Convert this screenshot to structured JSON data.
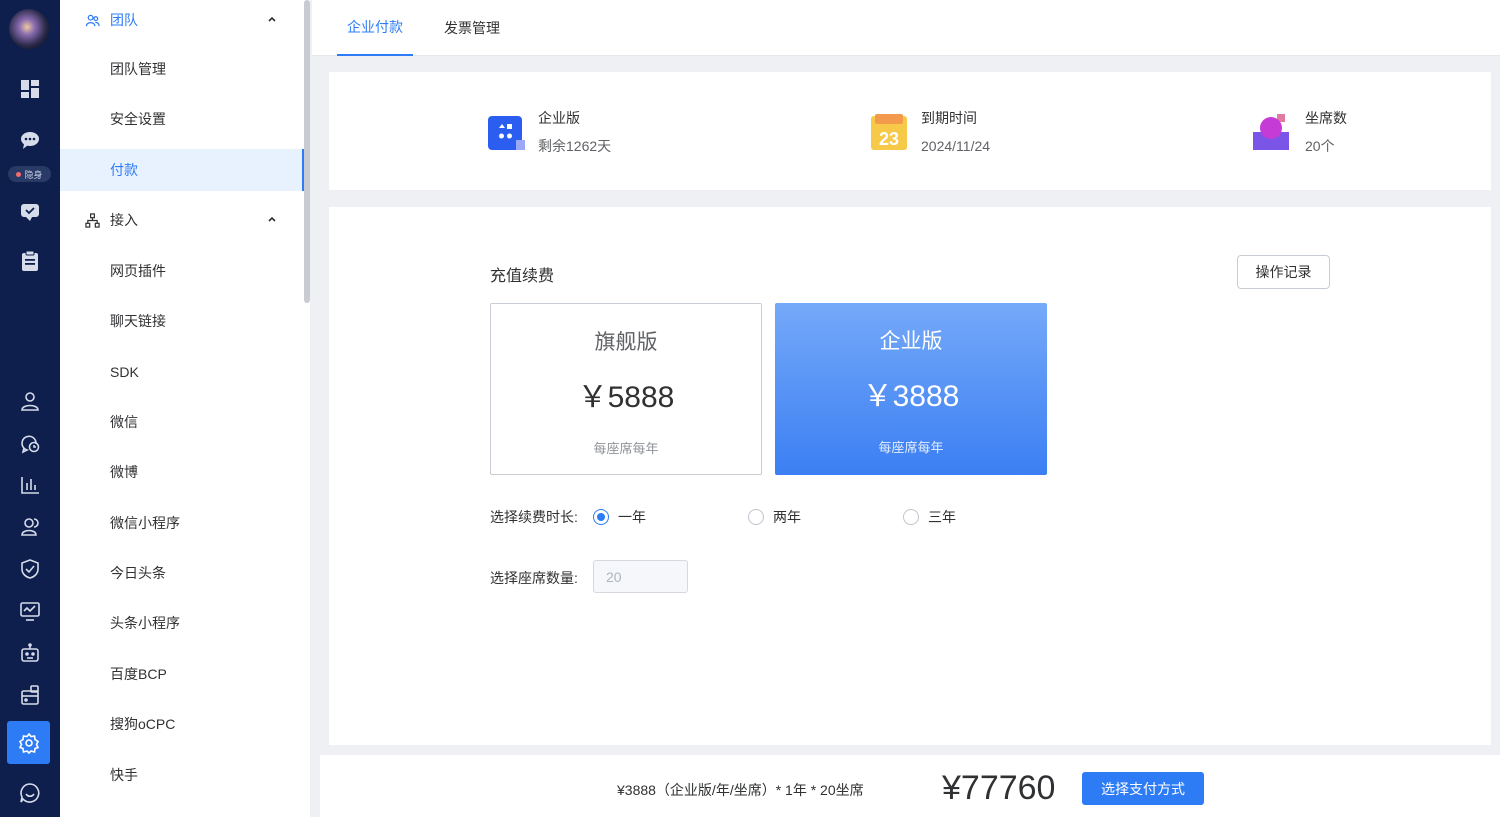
{
  "rail": {
    "status_label": "隐身"
  },
  "sidebar": {
    "group_team": "团队",
    "team_items": [
      "团队管理",
      "安全设置",
      "付款"
    ],
    "group_access": "接入",
    "access_items": [
      "网页插件",
      "聊天链接",
      "SDK",
      "微信",
      "微博",
      "微信小程序",
      "今日头条",
      "头条小程序",
      "百度BCP",
      "搜狗oCPC",
      "快手"
    ]
  },
  "tabs": [
    "企业付款",
    "发票管理"
  ],
  "info": {
    "plan_label": "企业版",
    "plan_remaining": "剩余1262天",
    "calendar_day": "23",
    "expire_label": "到期时间",
    "expire_value": "2024/11/24",
    "seats_label": "坐席数",
    "seats_value": "20个"
  },
  "renewal": {
    "title": "充值续费",
    "log_button": "操作记录",
    "plans": [
      {
        "name": "旗舰版",
        "price": "￥5888",
        "unit": "每座席每年"
      },
      {
        "name": "企业版",
        "price": "￥3888",
        "unit": "每座席每年"
      }
    ],
    "duration_label": "选择续费时长:",
    "durations": [
      "一年",
      "两年",
      "三年"
    ],
    "seat_label": "选择座席数量:",
    "seat_value": "20"
  },
  "footer": {
    "formula": "¥3888（企业版/年/坐席）* 1年 * 20坐席",
    "total": "¥77760",
    "pay_button": "选择支付方式"
  },
  "colors": {
    "accent": "#2d7cf6",
    "rail_bg": "#0e1e4d"
  }
}
